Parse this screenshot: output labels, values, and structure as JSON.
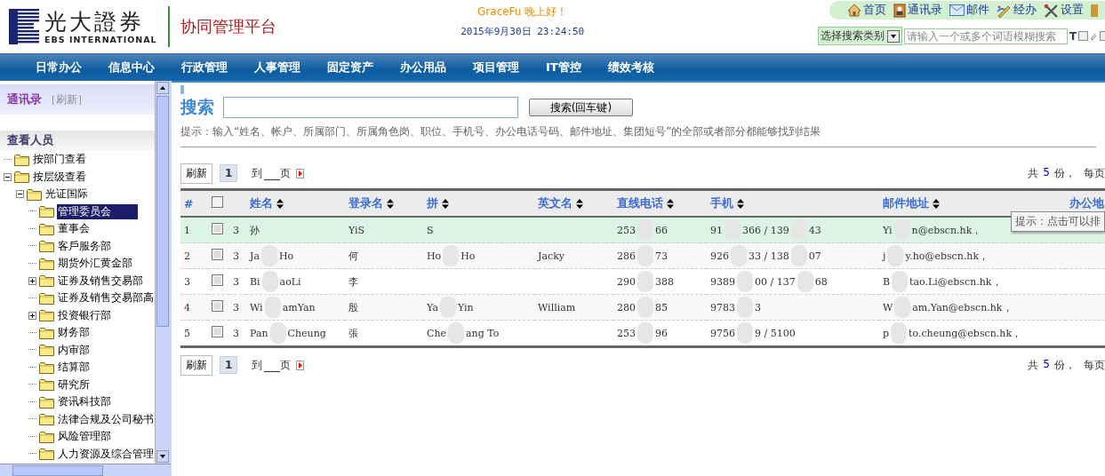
{
  "logo": {
    "cn": "光大證券",
    "en": "EBS INTERNATIONAL"
  },
  "platform_title": "协同管理平台",
  "greeting": {
    "user": "GraceFu",
    "text": "晚上好！",
    "datetime": "2015年9月30日 23:24:50"
  },
  "toolbar": [
    {
      "label": "首页",
      "kind": "home"
    },
    {
      "label": "通讯录",
      "kind": "contacts"
    },
    {
      "label": "邮件",
      "kind": "mail"
    },
    {
      "label": "经办",
      "kind": "pen"
    },
    {
      "label": "设置",
      "kind": "tools"
    }
  ],
  "quick_search": {
    "category": "选择搜索类别",
    "placeholder": "请输入一个或多个词语模糊搜索",
    "tool": "T"
  },
  "nav": [
    "日常办公",
    "信息中心",
    "行政管理",
    "人事管理",
    "固定资产",
    "办公用品",
    "项目管理",
    "IT管控",
    "绩效考核"
  ],
  "sidebar": {
    "title": "通讯录",
    "refresh": "［刷新］",
    "section": "查看人员",
    "tree": [
      {
        "label": "按部门查看",
        "kind": "leaf",
        "selected": false
      },
      {
        "label": "按层级查看",
        "kind": "branch",
        "expanded": true,
        "selected": false,
        "children": [
          {
            "label": "光证国际",
            "kind": "branch",
            "expanded": true,
            "selected": false,
            "children": [
              {
                "label": "管理委员会",
                "kind": "leaf",
                "selected": true
              },
              {
                "label": "董事会",
                "kind": "leaf",
                "selected": false
              },
              {
                "label": "客戶服务部",
                "kind": "leaf",
                "selected": false
              },
              {
                "label": "期货外汇黄金部",
                "kind": "leaf",
                "selected": false
              },
              {
                "label": "证券及销售交易部",
                "kind": "branch",
                "expanded": false,
                "selected": false
              },
              {
                "label": "证券及销售交易部高",
                "kind": "leaf",
                "selected": false
              },
              {
                "label": "投资银行部",
                "kind": "branch",
                "expanded": false,
                "selected": false
              },
              {
                "label": "财务部",
                "kind": "leaf",
                "selected": false
              },
              {
                "label": "内审部",
                "kind": "leaf",
                "selected": false
              },
              {
                "label": "结算部",
                "kind": "leaf",
                "selected": false
              },
              {
                "label": "研究所",
                "kind": "leaf",
                "selected": false
              },
              {
                "label": "资讯科技部",
                "kind": "leaf",
                "selected": false
              },
              {
                "label": "法律合规及公司秘书",
                "kind": "leaf",
                "selected": false
              },
              {
                "label": "风险管理部",
                "kind": "leaf",
                "selected": false
              },
              {
                "label": "人力资源及综合管理",
                "kind": "leaf",
                "selected": false
              }
            ]
          }
        ]
      }
    ]
  },
  "search": {
    "label": "搜索",
    "button": "搜索(回车键)",
    "hint": "提示：输入“姓名、帐户、所属部门、所属角色岗、职位、手机号、办公电话号码、邮件地址、集团短号”的全部或者部分都能够找到结果"
  },
  "pagers": [
    {
      "refresh": "刷新",
      "page": "1",
      "goto": "到",
      "goto_suffix": "页",
      "total_prefix": "共",
      "total": "5",
      "total_suffix": "份，",
      "per_page": "每页"
    },
    {
      "refresh": "刷新",
      "page": "1",
      "goto": "到",
      "goto_suffix": "页",
      "total_prefix": "共",
      "total": "5",
      "total_suffix": "份，",
      "per_page": "每页"
    }
  ],
  "table": {
    "select_all_checked": false,
    "columns": [
      "#",
      "",
      "",
      "姓名",
      "登录名",
      "拼",
      "英文名",
      "直线电话",
      "手机",
      "邮件地址",
      "办公地"
    ],
    "rows": [
      {
        "selected": true,
        "checked": false,
        "cells": [
          [
            "1"
          ],
          [],
          [
            "3"
          ],
          [
            "孙"
          ],
          [
            "YiS"
          ],
          [
            "S"
          ],
          [],
          [
            "253",
            "66"
          ],
          [
            "91",
            "366 / 139",
            "43"
          ],
          [
            "Yi",
            "n@ebscn.hk，"
          ]
        ]
      },
      {
        "selected": false,
        "checked": false,
        "cells": [
          [
            "2"
          ],
          [],
          [
            "3"
          ],
          [
            "Ja",
            "Ho"
          ],
          [
            "何"
          ],
          [
            "Ho",
            "Ho"
          ],
          [
            "Jacky"
          ],
          [
            "286",
            "73"
          ],
          [
            "926",
            "33 / 138",
            "07"
          ],
          [
            "j",
            "y.ho@ebscn.hk，"
          ]
        ]
      },
      {
        "selected": false,
        "checked": false,
        "cells": [
          [
            "3"
          ],
          [],
          [
            "3"
          ],
          [
            "Bi",
            "aoLi"
          ],
          [
            "李"
          ],
          [],
          [],
          [
            "290",
            "388"
          ],
          [
            "9389",
            "00 / 137",
            "68"
          ],
          [
            "B",
            "tao.Li@ebscn.hk，"
          ]
        ]
      },
      {
        "selected": false,
        "checked": false,
        "cells": [
          [
            "4"
          ],
          [],
          [
            "3"
          ],
          [
            "Wi",
            "amYan"
          ],
          [
            "殷"
          ],
          [
            "Ya",
            "Yin"
          ],
          [
            "William"
          ],
          [
            "280",
            "85"
          ],
          [
            "9783",
            "3"
          ],
          [
            "W",
            "am.Yan@ebscn.hk，"
          ]
        ]
      },
      {
        "selected": false,
        "checked": false,
        "cells": [
          [
            "5"
          ],
          [],
          [
            "3"
          ],
          [
            "Pan",
            "Cheung"
          ],
          [
            "張"
          ],
          [
            "Che",
            "ang To"
          ],
          [],
          [
            "253",
            "96"
          ],
          [
            "9756",
            "9 / 5100"
          ],
          [
            "p",
            "to.cheung@ebscn.hk，"
          ]
        ]
      }
    ]
  },
  "tooltip": "提示：点击可以排"
}
